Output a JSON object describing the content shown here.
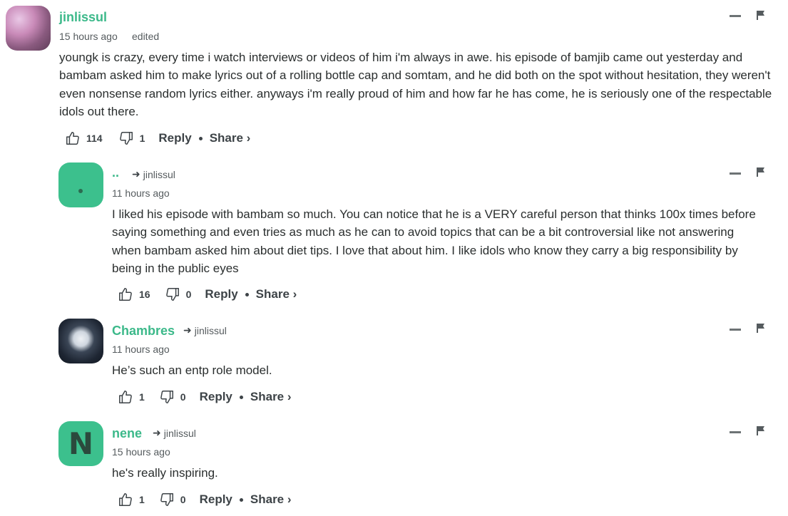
{
  "comments": [
    {
      "author": "jinlissul",
      "avatar_icon": "photo-avatar",
      "time": "15 hours ago",
      "edited": "edited",
      "reply_to": "",
      "text": "youngk is crazy, every time i watch interviews or videos of him i'm always in awe. his episode of bamjib came out yesterday and bambam asked him to make lyrics out of a rolling bottle cap and somtam, and he did both on the spot without hesitation, they weren't even nonsense random lyrics either. anyways i'm really proud of him and how far he has come, he is seriously one of the respectable idols out there.",
      "upvotes": "114",
      "downvotes": "1",
      "reply_label": "Reply",
      "share_label": "Share ›"
    },
    {
      "author": "..",
      "avatar_icon": "dot-avatar",
      "time": "11 hours ago",
      "reply_to": "jinlissul",
      "text": "I liked his episode with bambam so much. You can notice that he is a VERY careful person that thinks 100x times before saying something and even tries as much as he can to avoid topics that can be a bit controversial like not answering when bambam asked him about diet tips. I love that about him. I like idols who know they carry a big responsibility by being in the public eyes",
      "upvotes": "16",
      "downvotes": "0",
      "reply_label": "Reply",
      "share_label": "Share ›"
    },
    {
      "author": "Chambres",
      "avatar_icon": "night-sky-avatar",
      "time": "11 hours ago",
      "reply_to": "jinlissul",
      "text": "He’s such an entp role model.",
      "upvotes": "1",
      "downvotes": "0",
      "reply_label": "Reply",
      "share_label": "Share ›"
    },
    {
      "author": "nene",
      "avatar_letter": "N",
      "time": "15 hours ago",
      "reply_to": "jinlissul",
      "text": "he's really inspiring.",
      "upvotes": "1",
      "downvotes": "0",
      "reply_label": "Reply",
      "share_label": "Share ›"
    }
  ],
  "colors": {
    "author": "#3cb98a",
    "avatar_green": "#3cc08d",
    "text": "#2a2e2e",
    "meta": "#555b5e"
  }
}
